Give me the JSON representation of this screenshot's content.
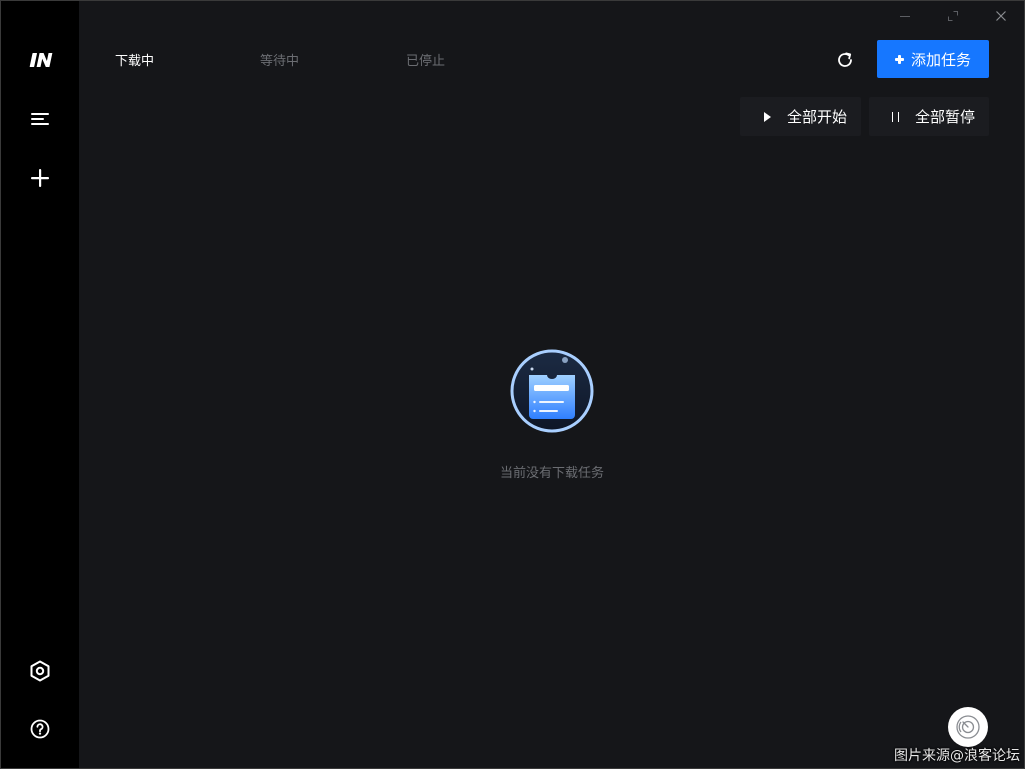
{
  "tabs": [
    {
      "label": "下载中",
      "active": true
    },
    {
      "label": "等待中",
      "active": false
    },
    {
      "label": "已停止",
      "active": false
    }
  ],
  "toolbar": {
    "add_task_label": "添加任务",
    "start_all_label": "全部开始",
    "pause_all_label": "全部暂停"
  },
  "empty_state": {
    "message": "当前没有下载任务"
  },
  "watermark": {
    "text": "图片来源@浪客论坛"
  },
  "icons": {
    "logo": "in-logo-icon",
    "menu": "menu-icon",
    "add": "plus-icon",
    "settings": "hexagon-settings-icon",
    "help": "help-icon",
    "refresh": "refresh-icon",
    "minimize": "minimize-icon",
    "maximize": "maximize-icon",
    "close": "close-icon",
    "float": "speed-gauge-icon"
  },
  "colors": {
    "accent": "#1677ff",
    "background": "#151619",
    "sidebar": "#000000",
    "text_inactive": "#6b6d72"
  }
}
